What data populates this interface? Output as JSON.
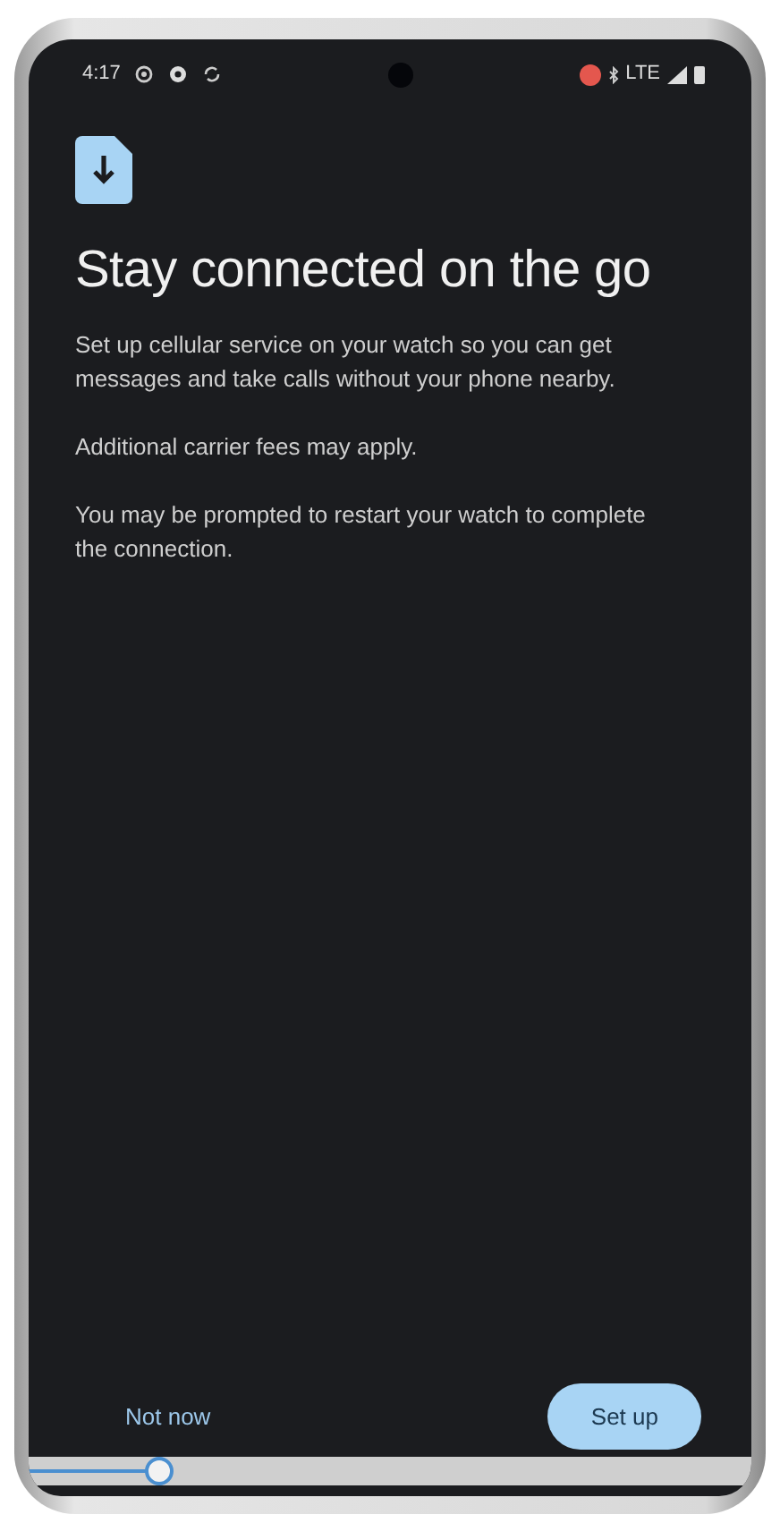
{
  "status_bar": {
    "time": "4:17",
    "network": "LTE"
  },
  "icon": {
    "kind": "sim-download"
  },
  "title": "Stay connected on the go",
  "paragraphs": [
    "Set up cellular service on your watch so you can get messages and take calls without your phone nearby.",
    "Additional carrier fees may apply.",
    "You may be prompted to restart your watch to complete the connection."
  ],
  "buttons": [
    {
      "label": "Not now",
      "kind": "text"
    },
    {
      "label": "Set up",
      "kind": "filled"
    }
  ],
  "playback": {
    "level": 0.18
  }
}
